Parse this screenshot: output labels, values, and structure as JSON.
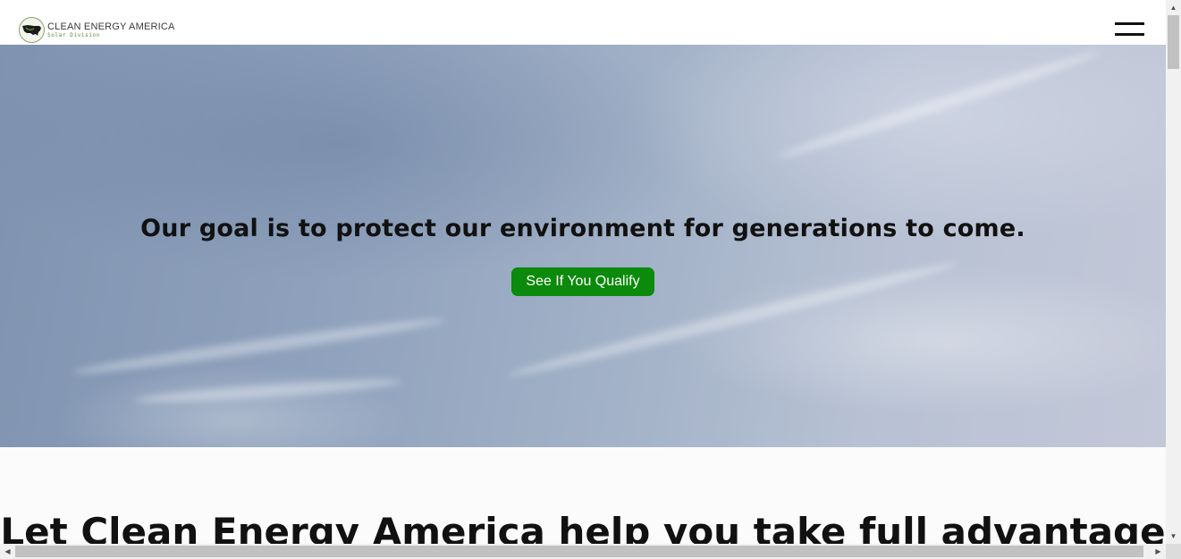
{
  "header": {
    "logo_title": "CLEAN ENERGY AMERICA",
    "logo_subtitle": "Solar Division",
    "logo_icon": "usa-map-icon",
    "menu_icon": "hamburger-menu-icon"
  },
  "hero": {
    "title": "Our goal is to protect our environment for generations to come.",
    "cta_label": "See If You Qualify",
    "cta_color": "#0b8a0b"
  },
  "section": {
    "heading": "Let Clean Energy America help you take full advantage"
  },
  "scrollbars": {
    "up_icon": "chevron-up-icon",
    "down_icon": "chevron-down-icon",
    "left_icon": "chevron-left-icon",
    "right_icon": "chevron-right-icon"
  }
}
